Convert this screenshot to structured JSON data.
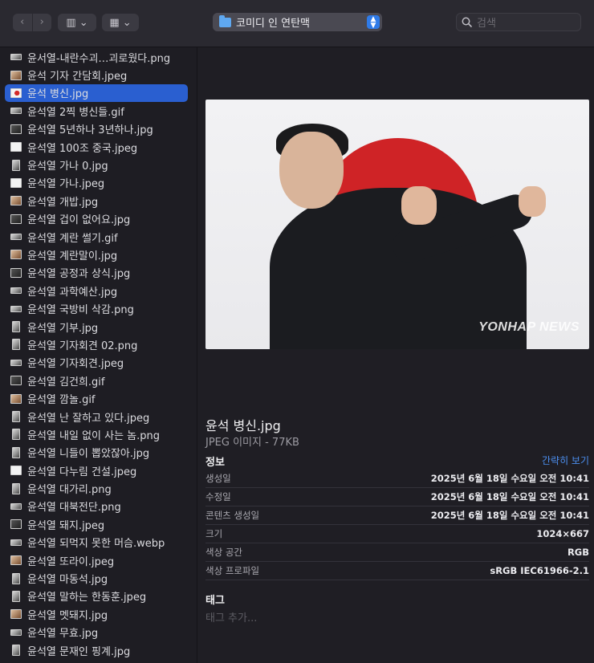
{
  "toolbar": {
    "back": "‹",
    "forward": "›",
    "view": "▥ ⌄",
    "group": "▦ ⌄",
    "path": "코미디 인 연탄맥",
    "search_placeholder": "검색"
  },
  "files": [
    {
      "name": "윤서열-내란수괴…괴로웠다.png",
      "thumb": "wide"
    },
    {
      "name": "윤석 기자 간담회.jpeg",
      "thumb": "warm"
    },
    {
      "name": "윤석 병신.jpg",
      "thumb": "flag",
      "selected": true
    },
    {
      "name": "윤석열 2찍 병신들.gif",
      "thumb": "wide"
    },
    {
      "name": "윤석열 5년하나 3년하나.jpg",
      "thumb": "dark"
    },
    {
      "name": "윤석열 100조 중국.jpeg",
      "thumb": "doc"
    },
    {
      "name": "윤석열 가나 0.jpg",
      "thumb": "tall"
    },
    {
      "name": "윤석열 가나.jpeg",
      "thumb": "doc"
    },
    {
      "name": "윤석열 개밥.jpg",
      "thumb": "warm"
    },
    {
      "name": "윤석열 겁이 없어요.jpg",
      "thumb": "dark"
    },
    {
      "name": "윤석열 계란 썰기.gif",
      "thumb": "wide"
    },
    {
      "name": "윤석열 계란말이.jpg",
      "thumb": "warm"
    },
    {
      "name": "윤석열 공정과 상식.jpg",
      "thumb": "dark"
    },
    {
      "name": "윤석열 과학예산.jpg",
      "thumb": "wide"
    },
    {
      "name": "윤석열 국방비 삭감.png",
      "thumb": "wide"
    },
    {
      "name": "윤석열 기부.jpg",
      "thumb": "tall"
    },
    {
      "name": "윤석열 기자회견 02.png",
      "thumb": "tall"
    },
    {
      "name": "윤석열 기자회견.jpeg",
      "thumb": "wide"
    },
    {
      "name": "윤석열 김건희.gif",
      "thumb": "dark"
    },
    {
      "name": "윤석열 깜놀.gif",
      "thumb": "warm"
    },
    {
      "name": "윤석열 난 잘하고 있다.jpeg",
      "thumb": "tall"
    },
    {
      "name": "윤석열 내일 없이 사는 놈.png",
      "thumb": "tall"
    },
    {
      "name": "윤석열 니들이 뽑았잖아.jpg",
      "thumb": "tall"
    },
    {
      "name": "윤석열 다누림 건설.jpeg",
      "thumb": "doc"
    },
    {
      "name": "윤석열 대가리.png",
      "thumb": "tall"
    },
    {
      "name": "윤석열 대북전단.png",
      "thumb": "wide"
    },
    {
      "name": "윤석열 돼지.jpeg",
      "thumb": "dark"
    },
    {
      "name": "윤석열 되먹지 못한 머슴.webp",
      "thumb": "wide"
    },
    {
      "name": "윤석열 또라이.jpeg",
      "thumb": "warm"
    },
    {
      "name": "윤석열 마동석.jpg",
      "thumb": "tall"
    },
    {
      "name": "윤석열 말하는 한동훈.jpeg",
      "thumb": "tall"
    },
    {
      "name": "윤석열 멧돼지.jpg",
      "thumb": "warm"
    },
    {
      "name": "윤석열 무효.jpg",
      "thumb": "wide"
    },
    {
      "name": "윤석열 문재인 핑계.jpg",
      "thumb": "tall"
    }
  ],
  "preview": {
    "watermark": "YONHAP NEWS",
    "filename": "윤석 병신.jpg",
    "filetype": "JPEG 이미지 - 77KB",
    "info_title": "정보",
    "show_less": "간략히 보기",
    "info": [
      {
        "key": "생성일",
        "value": "2025년 6월 18일 수요일 오전 10:41"
      },
      {
        "key": "수정일",
        "value": "2025년 6월 18일 수요일 오전 10:41"
      },
      {
        "key": "콘텐츠 생성일",
        "value": "2025년 6월 18일 수요일 오전 10:41"
      },
      {
        "key": "크기",
        "value": "1024×667"
      },
      {
        "key": "색상 공간",
        "value": "RGB"
      },
      {
        "key": "색상 프로파일",
        "value": "sRGB IEC61966-2.1"
      }
    ],
    "tags_title": "태그",
    "tags_placeholder": "태그 추가..."
  }
}
